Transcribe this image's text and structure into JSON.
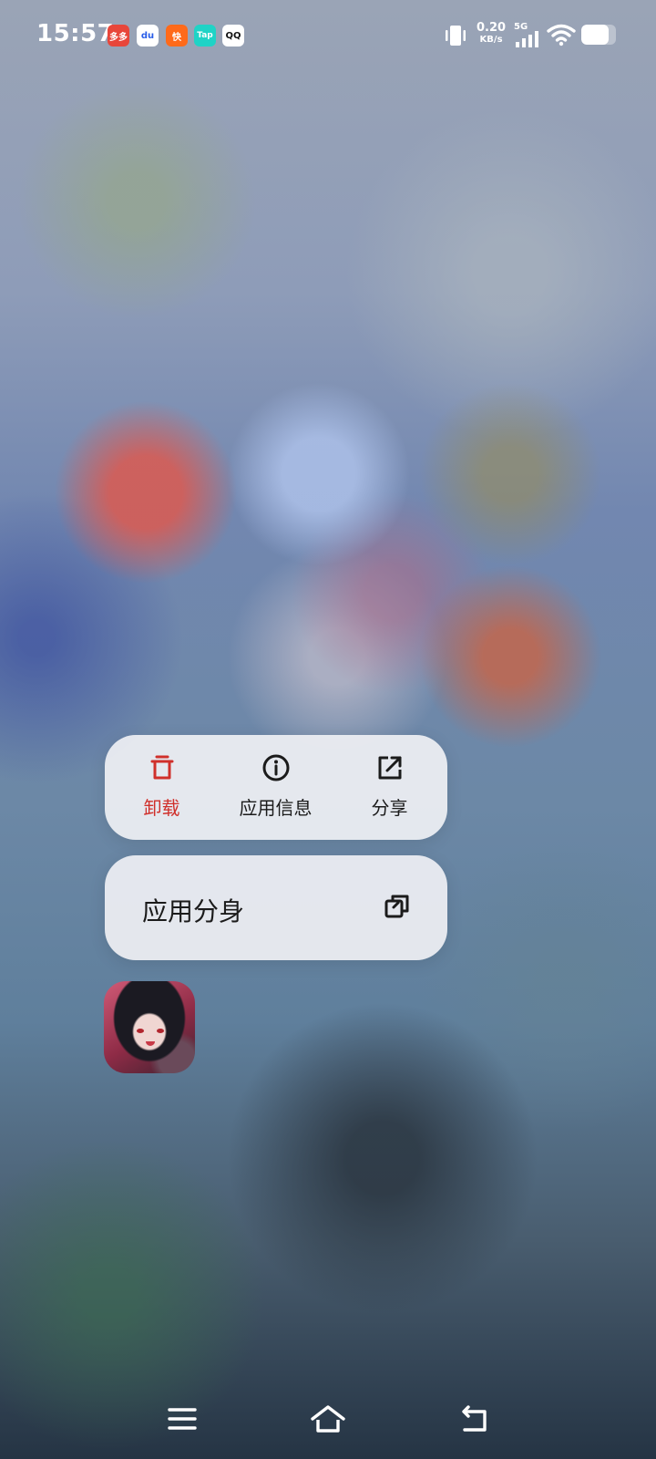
{
  "status_bar": {
    "time": "15:57",
    "notification_icons": [
      "pinduoduo-icon",
      "baidu-icon",
      "kuaishou-icon",
      "taptap-icon",
      "qq-icon"
    ],
    "notif_labels": [
      "多多",
      "du",
      "快",
      "Tap",
      "QQ"
    ],
    "network_speed_value": "0.20",
    "network_speed_unit": "KB/s",
    "network_type": "5G",
    "battery_level": 0.8
  },
  "menu": {
    "actions": [
      {
        "label": "卸载",
        "icon": "trash-icon",
        "color": "#d0302b"
      },
      {
        "label": "应用信息",
        "icon": "info-icon",
        "color": "#1b1b1b"
      },
      {
        "label": "分享",
        "icon": "share-icon",
        "color": "#1b1b1b"
      }
    ],
    "clone": {
      "label": "应用分身",
      "icon": "app-clone-icon"
    }
  },
  "app_icon": {
    "icon": "game-app-icon"
  },
  "nav_bar": {
    "buttons": [
      "menu-icon",
      "home-icon",
      "back-icon"
    ]
  }
}
